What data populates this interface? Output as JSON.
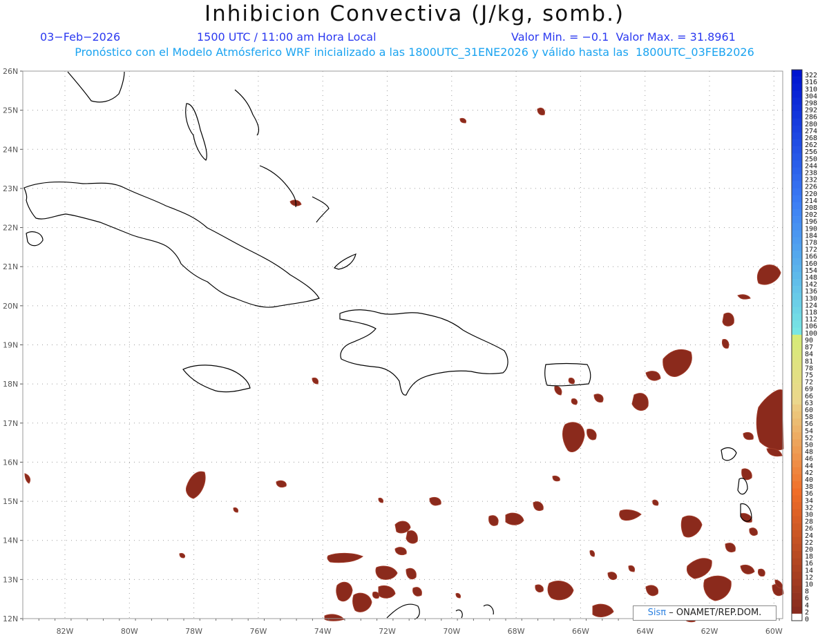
{
  "header": {
    "title": "Inhibicion Convectiva (J/kg, somb.)",
    "date": "03−Feb−2026",
    "time": "1500 UTC / 11:00 am Hora Local",
    "minmax": "Valor Min. = −0.1  Valor Max. = 31.8961",
    "subtitle": "Pronóstico con el Modelo Atmósferico WRF inicializado a las 1800UTC_31ENE2026 y válido hasta las  1800UTC_03FEB2026"
  },
  "map": {
    "lat_labels": [
      "26N",
      "25N",
      "24N",
      "23N",
      "22N",
      "21N",
      "20N",
      "19N",
      "18N",
      "17N",
      "16N",
      "15N",
      "14N",
      "13N",
      "12N"
    ],
    "lon_labels": [
      "82W",
      "80W",
      "78W",
      "76W",
      "74W",
      "72W",
      "70W",
      "68W",
      "66W",
      "64W",
      "62W",
      "60W"
    ],
    "colors": {
      "field": "#8b2a1c",
      "field_edge": "#a03a28",
      "coast": "#000000",
      "grid": "#9a9a9a"
    }
  },
  "colorbar": {
    "labels": [
      "322",
      "316",
      "310",
      "304",
      "298",
      "292",
      "286",
      "280",
      "274",
      "268",
      "262",
      "256",
      "250",
      "244",
      "238",
      "232",
      "226",
      "220",
      "214",
      "208",
      "202",
      "196",
      "190",
      "184",
      "178",
      "172",
      "166",
      "160",
      "154",
      "148",
      "142",
      "136",
      "130",
      "124",
      "118",
      "112",
      "106",
      "100",
      "90",
      "87",
      "84",
      "81",
      "78",
      "75",
      "72",
      "69",
      "66",
      "63",
      "60",
      "58",
      "56",
      "54",
      "52",
      "50",
      "48",
      "46",
      "44",
      "42",
      "40",
      "38",
      "36",
      "34",
      "32",
      "30",
      "28",
      "26",
      "24",
      "22",
      "20",
      "18",
      "16",
      "14",
      "12",
      "10",
      "8",
      "6",
      "4",
      "2",
      "0"
    ]
  },
  "credit": {
    "sis": "Sisπ",
    "text": "–  ONAMET/REP.DOM."
  }
}
